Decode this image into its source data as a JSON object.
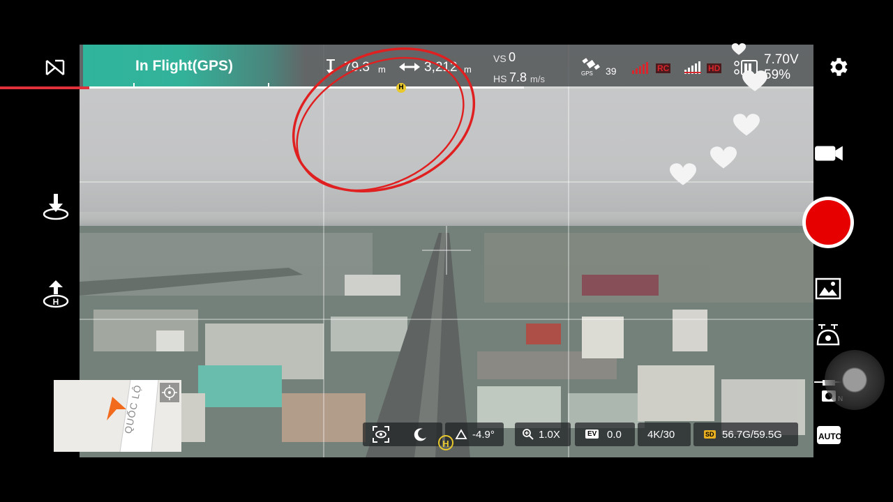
{
  "app_logo_icon": "dji-go-logo",
  "status": {
    "label": "In Flight(GPS)",
    "accent": "#2fb59c"
  },
  "telemetry": {
    "altitude_icon": "altitude-arrow-icon",
    "altitude_value": "79.3",
    "altitude_unit": "m",
    "distance_icon": "distance-arrows-icon",
    "distance_value": "3,212",
    "distance_unit": "m",
    "vs_label": "VS",
    "vs_value": "0",
    "hs_label": "HS",
    "hs_value": "7.8",
    "hs_unit": "m/s"
  },
  "signals": {
    "gps_label": "GPS",
    "gps_satellites": "39",
    "rc_label": "RC",
    "video_label": "HD",
    "battery_voltage": "7.70V",
    "battery_percent": "59%",
    "warning_color": "#d8262c"
  },
  "flight_progress": {
    "fraction": 0.6,
    "home_marker": "H"
  },
  "left_rail": {
    "takeoff_icon": "auto-takeoff-icon",
    "return_home_icon": "return-to-home-icon"
  },
  "right_rail": {
    "settings_icon": "gear-icon",
    "camera_mode_icon": "video-camera-icon",
    "record_icon": "record-button-icon",
    "playback_icon": "gallery-icon",
    "gimbal_icon": "gimbal-icon",
    "camera_settings_icon": "drone-camera-icon",
    "camera_settings_suffix": "N",
    "auto_label": "AUTO",
    "record_color": "#e60000"
  },
  "bottom_bar": {
    "focus_icon": "focus-frame-icon",
    "eye_icon": "eye-icon",
    "night_icon": "moon-icon",
    "gimbal_angle": "-4.9°",
    "zoom_icon": "zoom-icon",
    "zoom": "1.0X",
    "ev_label": "EV",
    "ev_value": "0.0",
    "resolution": "4K/30",
    "sd_label": "SD",
    "storage": "56.7G/59.5G",
    "home_marker": "H"
  },
  "minimap": {
    "street_label": "QUỐC LỘ",
    "aircraft_icon": "aircraft-arrow-icon",
    "recenter_icon": "crosshair-icon"
  },
  "overlay": {
    "annotation_color": "#e02020",
    "heart_icon": "heart-icon"
  }
}
